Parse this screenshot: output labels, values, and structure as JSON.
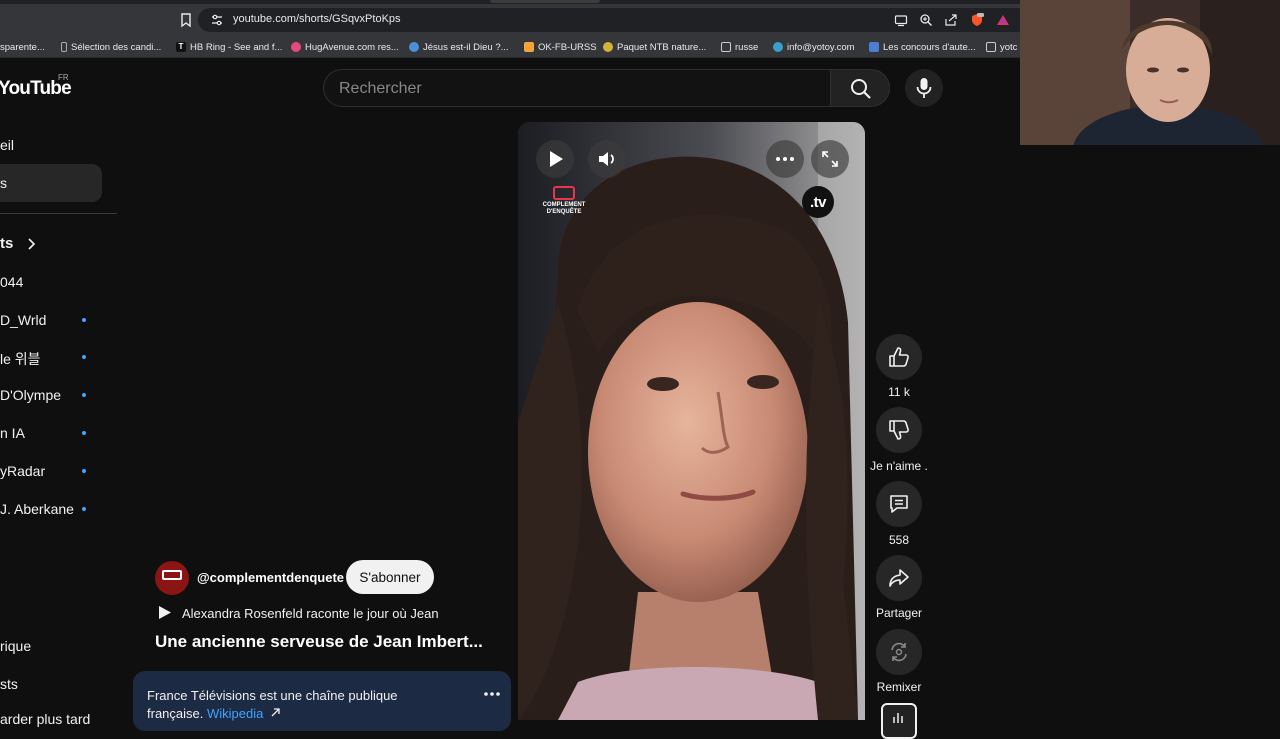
{
  "browser": {
    "url": "youtube.com/shorts/GSqvxPtoKps",
    "bookmarks": [
      {
        "label": "sparente...",
        "color": "#e36d3c"
      },
      {
        "label": "Sélection des candi...",
        "color": "#777777"
      },
      {
        "label": "HB Ring - See and f...",
        "color": "#111111"
      },
      {
        "label": "HugAvenue.com res...",
        "color": "#e8487a"
      },
      {
        "label": "Jésus est-il Dieu ?...",
        "color": "#4a90d9"
      },
      {
        "label": "OK-FB-URSS",
        "color": "#f2a33a"
      },
      {
        "label": "Paquet NTB nature...",
        "color": "#d4b23a"
      },
      {
        "label": "russe",
        "color": "#8a8a8a"
      },
      {
        "label": "info@yotoy.com",
        "color": "#3aa0c8"
      },
      {
        "label": "Les concours d'aute...",
        "color": "#4a7fd4"
      },
      {
        "label": "yotc",
        "color": "#8a8a8a"
      }
    ]
  },
  "youtube": {
    "logo": "YouTube",
    "region": "FR",
    "search_placeholder": "Rechercher"
  },
  "sidebar": {
    "items": [
      {
        "label": "eil"
      },
      {
        "label": "s"
      },
      {
        "label": "ts"
      },
      {
        "label": "044"
      },
      {
        "label": "D_Wrld"
      },
      {
        "label": "le 위블"
      },
      {
        "label": "D'Olympe"
      },
      {
        "label": "n IA"
      },
      {
        "label": "yRadar"
      },
      {
        "label": "J. Aberkane"
      },
      {
        "label": "rique"
      },
      {
        "label": "sts"
      },
      {
        "label": "arder plus tard"
      }
    ]
  },
  "video": {
    "overlay_logo_line1": "COMPLEMENT",
    "overlay_logo_line2": "D'ENQUÊTE",
    "broadcaster_badge": ".tv"
  },
  "actions": {
    "likes": "11 k",
    "dislike_label": "Je n'aime .",
    "comments": "558",
    "share_label": "Partager",
    "remix_label": "Remixer"
  },
  "meta": {
    "channel": "@complementdenquete",
    "subscribe_label": "S'abonner",
    "description": "Alexandra Rosenfeld raconte le jour où Jean",
    "title": "Une ancienne serveuse de Jean Imbert...",
    "info_text_1": "France Télévisions est une chaîne publique",
    "info_text_2": "française.",
    "info_link": "Wikipedia"
  }
}
